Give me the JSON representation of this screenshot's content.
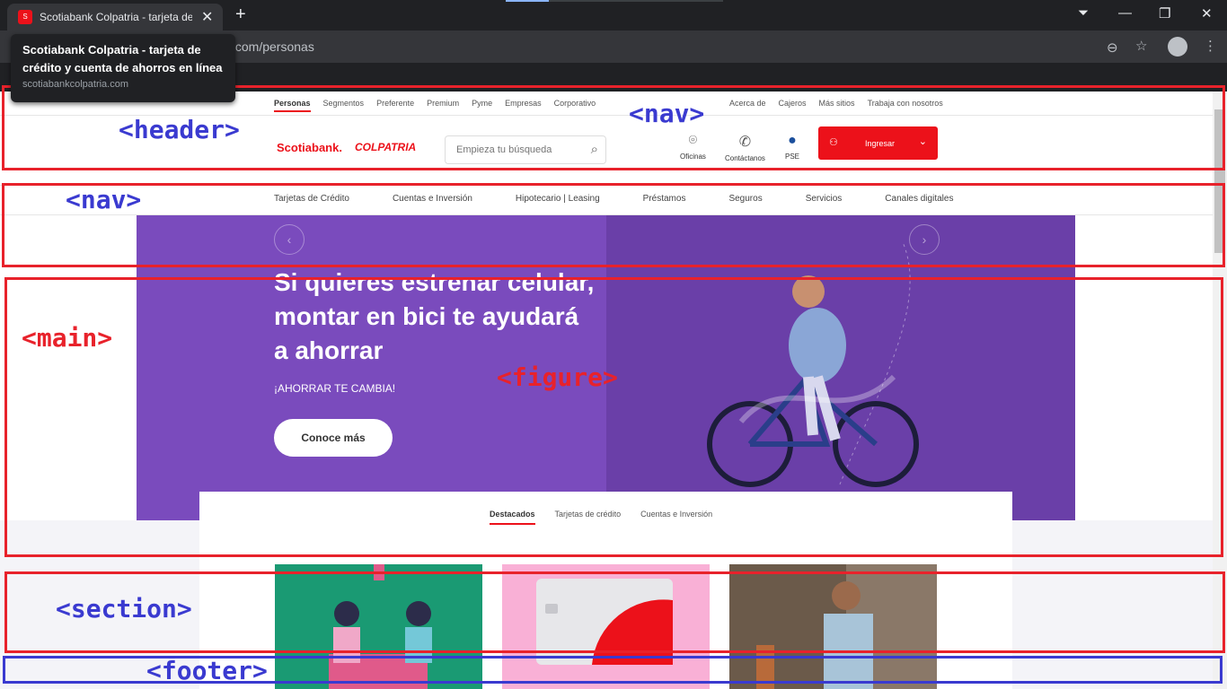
{
  "browser": {
    "tab_title": "Scotiabank Colpatria - tarjeta de",
    "url_fragment": ".com/personas",
    "tooltip_title": "Scotiabank Colpatria - tarjeta de crédito y cuenta de ahorros en línea",
    "tooltip_url": "scotiabankcolpatria.com"
  },
  "top_nav": {
    "left": [
      "Personas",
      "Segmentos",
      "Preferente",
      "Premium",
      "Pyme",
      "Empresas",
      "Corporativo"
    ],
    "right": [
      "Acerca de",
      "Cajeros",
      "Más sitios",
      "Trabaja con nosotros"
    ]
  },
  "header": {
    "logo_scotiabank": "Scotiabank.",
    "logo_colpatria": "COLPATRIA",
    "search_placeholder": "Empieza tu búsqueda",
    "icons": [
      "Oficinas",
      "Contáctanos",
      "PSE"
    ],
    "login_label": "Ingresar"
  },
  "main_nav": [
    "Tarjetas de Crédito",
    "Cuentas e Inversión",
    "Hipotecario | Leasing",
    "Préstamos",
    "Seguros",
    "Servicios",
    "Canales digitales"
  ],
  "hero": {
    "headline": "Si quieres estrenar celular, montar en bici te ayudará a ahorrar",
    "subline": "¡AHORRAR TE CAMBIA!",
    "cta": "Conoce más"
  },
  "product_tabs": [
    "Destacados",
    "Tarjetas de crédito",
    "Cuentas e Inversión"
  ],
  "annotations": {
    "header": "<header>",
    "nav_top": "<nav>",
    "nav_main": "<nav>",
    "main": "<main>",
    "figure": "<figure>",
    "section": "<section>",
    "footer": "<footer>"
  },
  "colors": {
    "brand_red": "#ec111a",
    "hero_purple": "#7a4bbd",
    "annotation_red": "#e8222b",
    "annotation_blue": "#3a3ad0"
  }
}
